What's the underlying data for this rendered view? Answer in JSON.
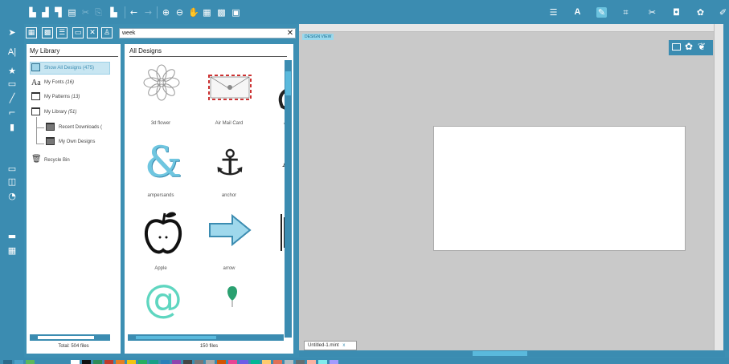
{
  "toolbar": {
    "left_icons": [
      "new-icon",
      "open-icon",
      "save-icon",
      "print-icon",
      "cut-icon",
      "copy-icon",
      "paste-icon",
      "undo-icon",
      "redo-icon",
      "zoom-in-icon",
      "zoom-out-icon",
      "pan-icon",
      "select-all-icon",
      "group-icon",
      "ungroup-icon"
    ],
    "right_icons": [
      "align-icon",
      "text-icon",
      "pen-icon",
      "crop-icon",
      "scissors-icon",
      "shape-icon",
      "palette-icon",
      "edit-icon"
    ]
  },
  "library": {
    "search_value": "week",
    "tree_title": "My Library",
    "tree_items": [
      {
        "label": "Show All Designs",
        "count": "(475)"
      },
      {
        "label": "My Fonts",
        "count": "(16)"
      },
      {
        "label": "My Patterns",
        "count": "(13)"
      },
      {
        "label": "My Library",
        "count": "(51)"
      },
      {
        "label": "Recent Downloads (",
        "count": ""
      },
      {
        "label": "My Own Designs",
        "count": ""
      },
      {
        "label": "Recycle Bin",
        "count": ""
      }
    ],
    "total": "Total: 504 files",
    "designs_title": "All Designs",
    "designs": [
      {
        "label": "3d flower"
      },
      {
        "label": "Air Mail Card"
      },
      {
        "label": "A"
      },
      {
        "label": "ampersands"
      },
      {
        "label": "anchor"
      },
      {
        "label": "Apple"
      },
      {
        "label": "arrow"
      }
    ],
    "file_count": "150 files"
  },
  "canvas": {
    "view_label": "DESIGN VIEW",
    "tab_label": "Untitled-1.mint",
    "tab_close": "x"
  },
  "colors": {
    "accent": "#3b8cb1",
    "highlight": "#6bc2de",
    "selection": "#c8e6f2"
  }
}
